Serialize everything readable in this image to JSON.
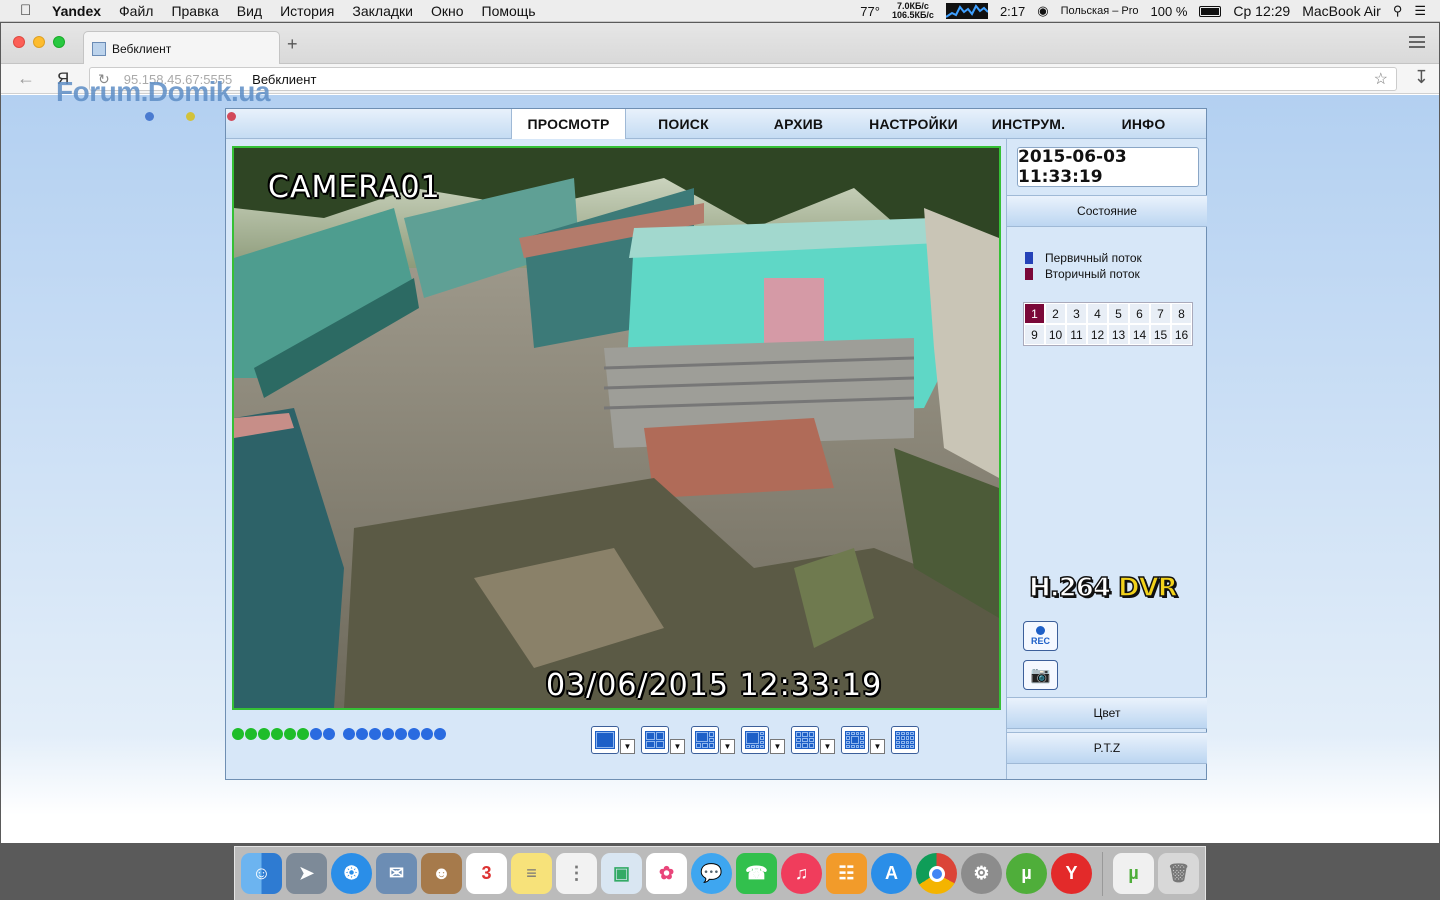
{
  "menubar": {
    "app": "Yandex",
    "items": [
      "Файл",
      "Правка",
      "Вид",
      "История",
      "Закладки",
      "Окно",
      "Помощь"
    ],
    "temperature": "77°",
    "net_up": "7.0КБ/с",
    "net_down": "106.5КБ/с",
    "timer": "2:17",
    "keyboard": "Польская – Pro",
    "battery": "100 %",
    "clock": "Ср 12:29",
    "device": "MacBook Air"
  },
  "browser": {
    "tab_title": "Вебклиент",
    "new_tab": "+",
    "url": "95.158.45.67:5555",
    "page_title": "Вебклиент",
    "watermark": "Forum.Domik.ua"
  },
  "dvr": {
    "nav": [
      "ПРОСМОТР",
      "ПОИСК",
      "АРХИВ",
      "НАСТРОЙКИ",
      "ИНСТРУМ.",
      "ИНФО"
    ],
    "active_nav": 0,
    "camera_name": "CAMERA01",
    "overlay_time": "03/06/2015 12:33:19",
    "datetime": "2015-06-03 11:33:19",
    "status_label": "Состояние",
    "primary_stream": "Первичный поток",
    "secondary_stream": "Вторичный поток",
    "primary_color": "#2442b8",
    "secondary_color": "#7a0838",
    "channels": [
      "1",
      "2",
      "3",
      "4",
      "5",
      "6",
      "7",
      "8",
      "9",
      "10",
      "11",
      "12",
      "13",
      "14",
      "15",
      "16"
    ],
    "selected_channel": "1",
    "logo_h264": "H.264",
    "logo_dvr": "DVR",
    "rec_label": "REC",
    "color_label": "Цвет",
    "ptz_label": "P.T.Z",
    "green_dots": 8,
    "blue_dots": 8
  }
}
